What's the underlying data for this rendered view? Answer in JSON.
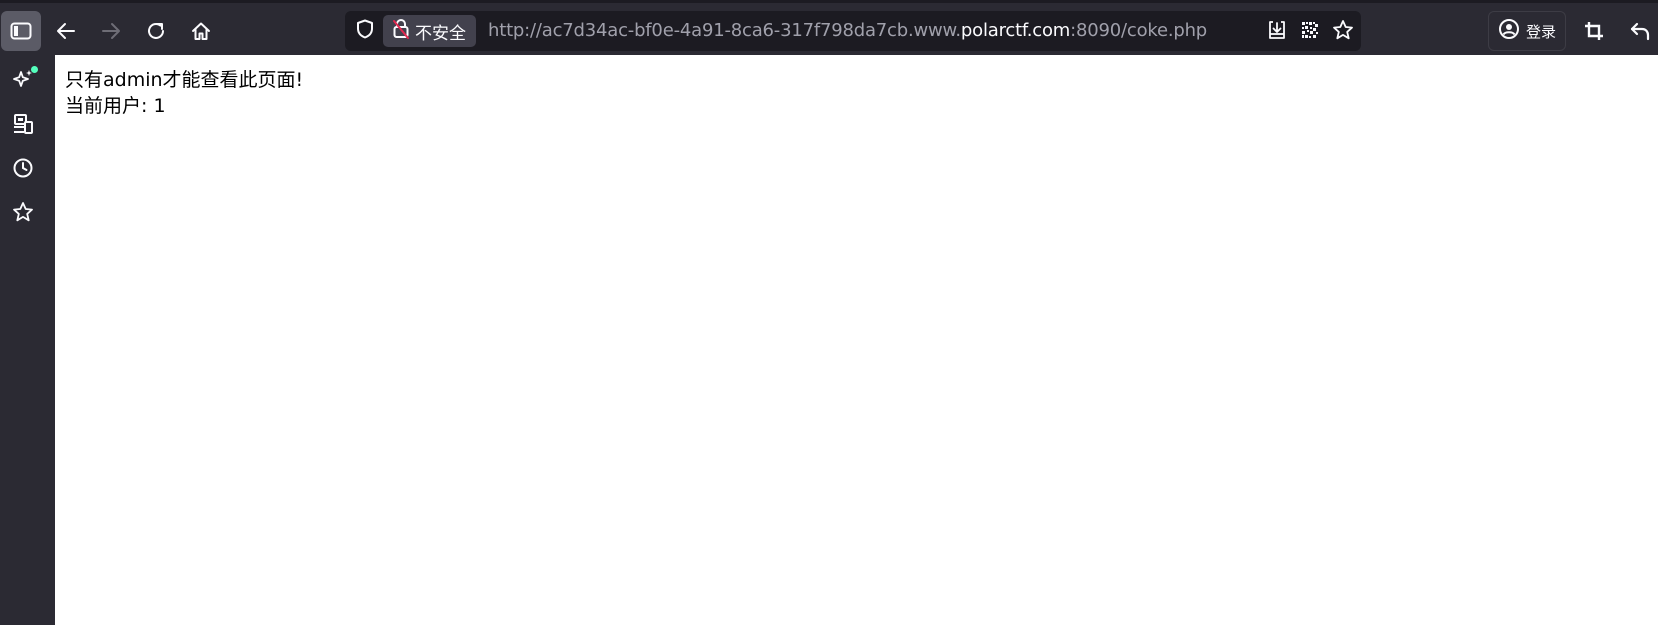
{
  "browser": {
    "url": {
      "prefix": "http://ac7d34ac-bf0e-4a91-8ca6-317f798da7cb.www.",
      "domain": "polarctf.com",
      "suffix": ":8090/coke.php"
    },
    "security_label": "不安全",
    "login_label": "登录",
    "icons": {
      "sidebar_toggle": "sidebar-icon",
      "back": "arrow-left-icon",
      "forward": "arrow-right-icon",
      "reload": "reload-icon",
      "home": "home-icon",
      "shield": "shield-icon",
      "insecure": "insecure-lock-icon",
      "download": "download-icon",
      "qr": "qr-code-icon",
      "bookmark_star": "star-icon",
      "account": "account-icon",
      "crop": "crop-icon",
      "undo": "undo-icon"
    },
    "sidebar": [
      {
        "icon": "ai-sparkle-icon",
        "has_notification": true
      },
      {
        "icon": "synced-devices-icon"
      },
      {
        "icon": "history-clock-icon"
      },
      {
        "icon": "bookmarks-star-icon"
      }
    ],
    "colors": {
      "toolbar_bg": "#2b2a33",
      "urlbar_bg": "#1c1b22",
      "notification_dot": "#54ffbd",
      "insecure_accent": "#e22850"
    }
  },
  "page": {
    "line1": "只有admin才能查看此页面!",
    "line2": "当前用户: 1"
  }
}
